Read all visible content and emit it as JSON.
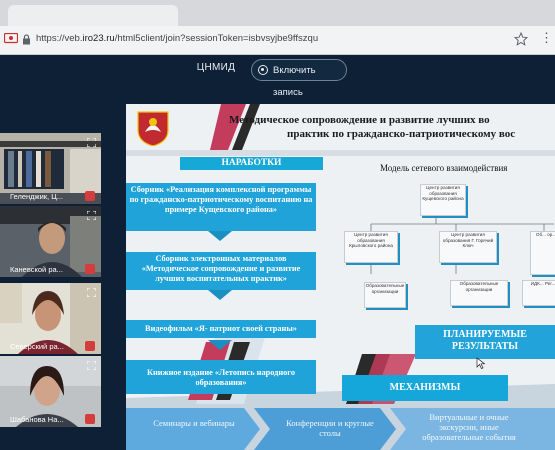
{
  "browser": {
    "url_prefix": "https://veb.",
    "url_host": "iro23.ru",
    "url_path": "/html5client/join?sessionToken=isbvsyjbe9ffszqu"
  },
  "meeting": {
    "title": "ЦНМИД",
    "record_label": "Включить запись"
  },
  "participants": [
    {
      "name": "Геленджик, Ц..."
    },
    {
      "name": "Каневской ра..."
    },
    {
      "name": "Северский ра..."
    },
    {
      "name": "Шабанова На..."
    }
  ],
  "slide": {
    "title_line1": "Методическое сопровождение и развитие лучших во",
    "title_line2": "практик по гражданско-патриотическому вос",
    "developments_label": "НАРАБОТКИ",
    "developments": [
      "Сборник «Реализация комплексной программы по гражданско-патриотическому воспитанию на примере Кущевского района»",
      "Сборник электронных материалов «Методическое сопровождение и развитие лучших воспитательных практик»",
      "Видеофильм «Я- патриот своей страны»",
      "Книжное издание «Летопись народного образования»"
    ],
    "model_title": "Модель сетевого взаимодействия",
    "nodes": {
      "center": "Центр развития образования Кущевского района",
      "left": "Центр развития образования Крыловского района",
      "middle": "Центр развития образования Г. Горячий Ключ",
      "right": "Об... ор...",
      "right2": "ИДК... Рег...",
      "org1": "Образовательные организации",
      "org2": "Образовательные организации"
    },
    "planned_results": "ПЛАНИРУЕМЫЕ РЕЗУЛЬТАТЫ",
    "mechanisms_label": "МЕХАНИЗМЫ",
    "mechanisms": [
      "Семинары и вебинары",
      "Конференции и круглые столы",
      "Виртуальные и очные экскурсии, иные образовательные события"
    ]
  },
  "colors": {
    "background": "#0d2035",
    "accent": "#1fa3d8",
    "slide_bg": "#ecf0f3"
  }
}
